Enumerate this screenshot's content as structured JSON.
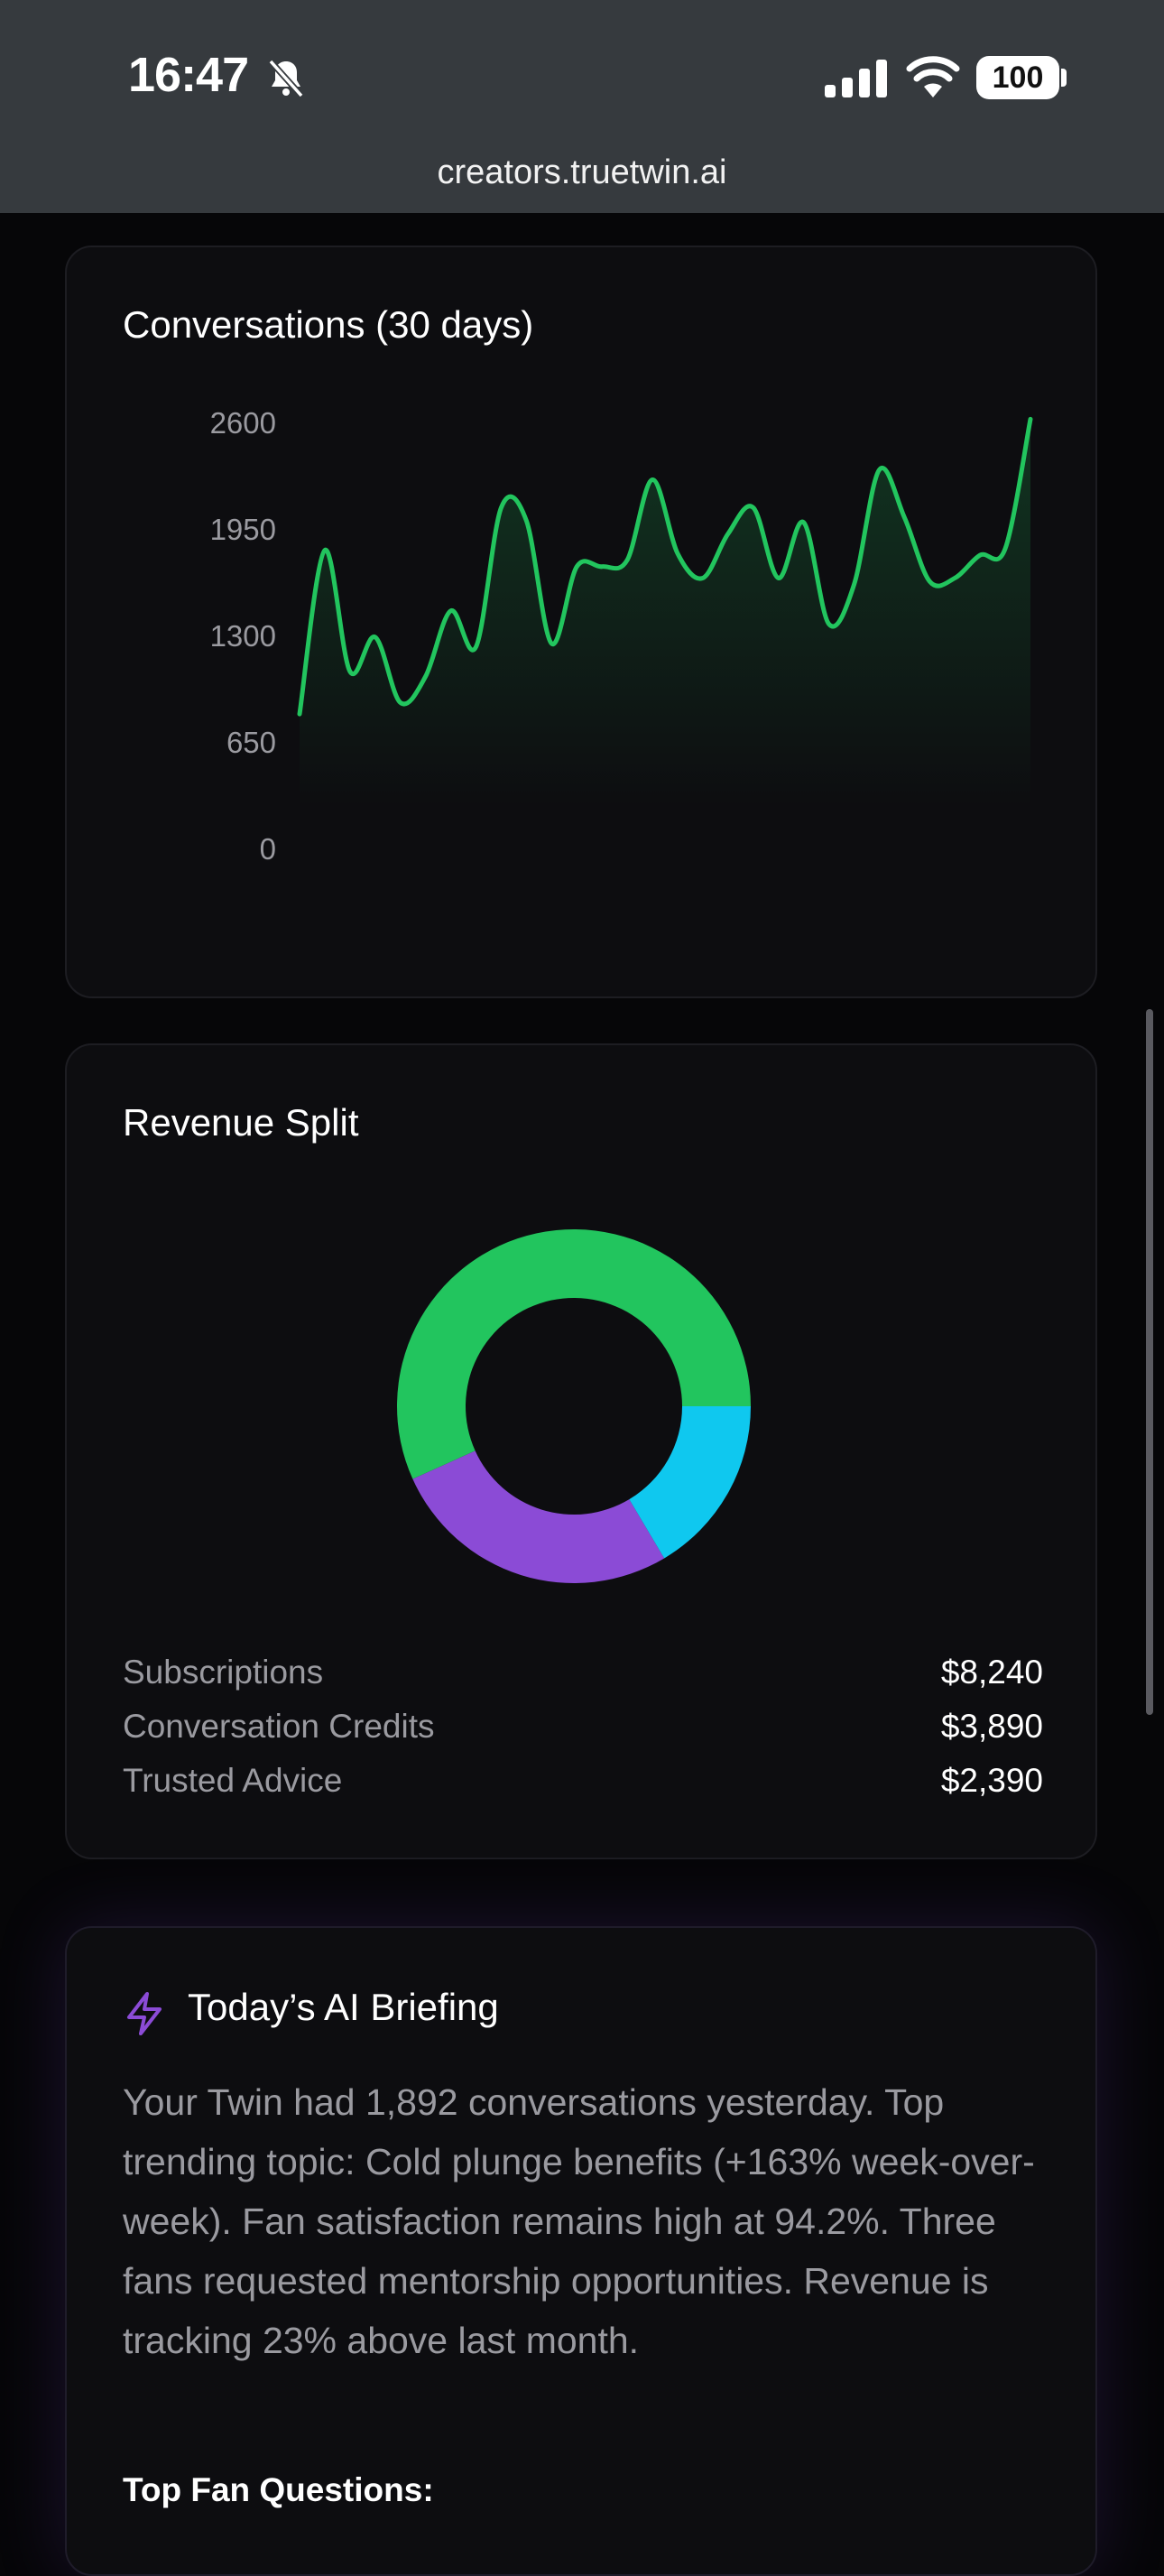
{
  "status_bar": {
    "time": "16:47",
    "battery": "100",
    "icons": [
      "bell-slash-icon",
      "cellular-signal-icon",
      "wifi-icon",
      "battery-icon"
    ]
  },
  "browser": {
    "url": "creators.truetwin.ai"
  },
  "conversations": {
    "title": "Conversations (30 days)",
    "chart_data": {
      "type": "area",
      "title": "Conversations (30 days)",
      "xlabel": "",
      "ylabel": "",
      "ylim": [
        0,
        2600
      ],
      "yticks": [
        "2600",
        "1950",
        "1300",
        "650",
        "0"
      ],
      "grid": false,
      "series": [
        {
          "color": "#22c55e",
          "values": [
            820,
            1820,
            1080,
            1290,
            890,
            1050,
            1450,
            1230,
            2080,
            2000,
            1250,
            1720,
            1720,
            1760,
            2250,
            1800,
            1650,
            1920,
            2080,
            1650,
            1990,
            1370,
            1610,
            2310,
            2020,
            1630,
            1650,
            1790,
            1830,
            2620
          ]
        }
      ]
    }
  },
  "revenue": {
    "title": "Revenue Split",
    "chart_data": {
      "type": "pie",
      "donut": true,
      "categories": [
        "Subscriptions",
        "Conversation Credits",
        "Trusted Advice"
      ],
      "values": [
        8240,
        3890,
        2390
      ],
      "colors": [
        "#22c55e",
        "#8b4bd6",
        "#0fc8ef"
      ]
    },
    "items": [
      {
        "label": "Subscriptions",
        "value": "$8,240"
      },
      {
        "label": "Conversation Credits",
        "value": "$3,890"
      },
      {
        "label": "Trusted Advice",
        "value": "$2,390"
      }
    ]
  },
  "briefing": {
    "title": "Today’s AI Briefing",
    "icon": "lightning-bolt-icon",
    "text": "Your Twin had 1,892 conversations yesterday. Top trending topic: Cold plunge benefits (+163% week-over-week). Fan satisfaction remains high at 94.2%. Three fans requested mentorship opportunities. Revenue is tracking 23% above last month.",
    "top_questions_label": "Top Fan Questions:"
  },
  "colors": {
    "accent": "#22c55e",
    "purple": "#8b4bd6",
    "cyan": "#0fc8ef"
  }
}
